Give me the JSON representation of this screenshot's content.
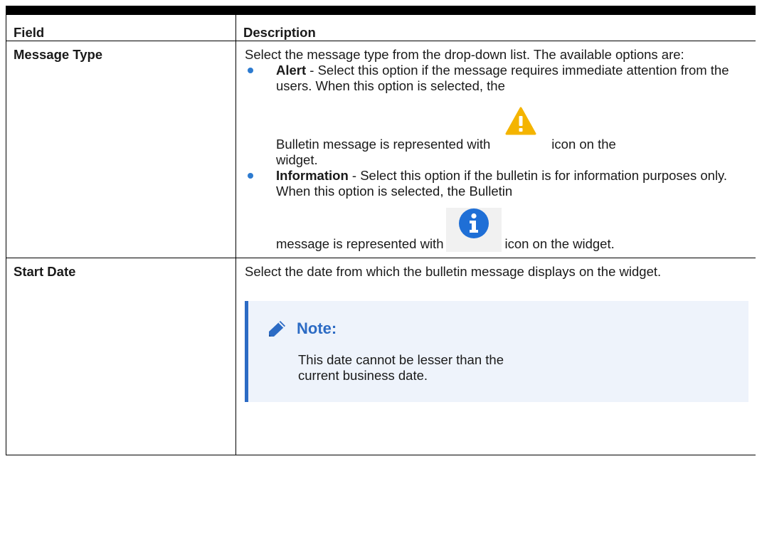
{
  "table": {
    "headers": {
      "field": "Field",
      "description": "Description"
    },
    "rows": {
      "message_type": {
        "field": "Message Type",
        "intro": "Select the message type from the drop-down list. The available options are:",
        "options": {
          "alert": {
            "label": "Alert",
            "text_before_icon": " - Select this option if the message requires immediate attention from the users. When this option is selected, the",
            "line_before_icon": "Bulletin message is represented with",
            "after_icon": "icon on the",
            "tail": "widget.",
            "icon": "warning-triangle-icon",
            "icon_color": "#f4b400"
          },
          "information": {
            "label": "Information",
            "text_before_icon": " - Select this option if the bulletin is for information purposes only. When this option is selected, the Bulletin",
            "line_before_icon": "message is represented with",
            "after_icon": "icon on the widget.",
            "icon": "info-circle-icon",
            "icon_color": "#1f6fd6"
          }
        }
      },
      "start_date": {
        "field": "Start Date",
        "description": "Select the date from which the bulletin message displays on the widget.",
        "note": {
          "title": "Note:",
          "icon": "pencil-icon",
          "text": "This date cannot be lesser than the current business date."
        }
      }
    }
  },
  "colors": {
    "bullet": "#2d7bd0",
    "note_accent": "#2c6bc4",
    "note_background": "#eef3fb"
  }
}
